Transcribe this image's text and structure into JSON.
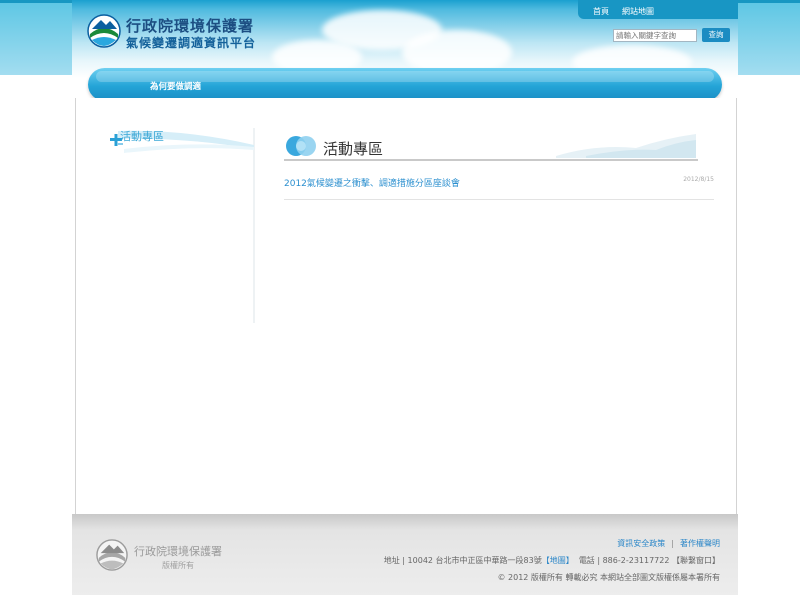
{
  "header": {
    "agency": "行政院環境保護署",
    "platform": "氣候變遷調適資訊平台",
    "links": [
      "首頁",
      "網站地圖"
    ],
    "search_placeholder": "請輸入關鍵字查詢",
    "search_button": "查詢"
  },
  "nav": {
    "items": [
      "為何要做調適"
    ]
  },
  "sidebar": {
    "title": "活動專區"
  },
  "main": {
    "title": "活動專區",
    "items": [
      {
        "title": "2012氣候變遷之衝擊、調適措施分區座談會",
        "date": "2012/8/15"
      }
    ]
  },
  "footer": {
    "agency": "行政院環境保護署",
    "rights": "版權所有",
    "links": [
      "資訊安全政策",
      "著作權聲明"
    ],
    "address_label": "地址 | 10042 台北市中正區中華路一段83號",
    "map_link": "【地圖】",
    "phone": "電話 | 886-2-23117722",
    "contact_link": "【聯繫窗口】",
    "copyright": "© 2012 版權所有 轉載必究 本網站全部圖文版權係屬本署所有"
  },
  "colors": {
    "brand_blue": "#1a8dc4",
    "link_blue": "#2a86c8",
    "header_top": "#1797c2"
  }
}
